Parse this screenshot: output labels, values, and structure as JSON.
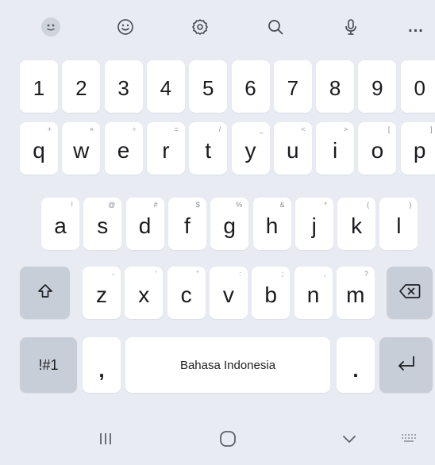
{
  "toolbar": {
    "icons": [
      "emoji-face-icon",
      "smiley-icon",
      "settings-gear-icon",
      "search-icon",
      "microphone-icon",
      "more-icon"
    ],
    "more_label": "..."
  },
  "keyboard": {
    "number_row": [
      "1",
      "2",
      "3",
      "4",
      "5",
      "6",
      "7",
      "8",
      "9",
      "0"
    ],
    "row1": [
      {
        "main": "q",
        "hint": "+"
      },
      {
        "main": "w",
        "hint": "×"
      },
      {
        "main": "e",
        "hint": "÷"
      },
      {
        "main": "r",
        "hint": "="
      },
      {
        "main": "t",
        "hint": "/"
      },
      {
        "main": "y",
        "hint": "_"
      },
      {
        "main": "u",
        "hint": "<"
      },
      {
        "main": "i",
        "hint": ">"
      },
      {
        "main": "o",
        "hint": "["
      },
      {
        "main": "p",
        "hint": "]"
      }
    ],
    "row2": [
      {
        "main": "a",
        "hint": "!"
      },
      {
        "main": "s",
        "hint": "@"
      },
      {
        "main": "d",
        "hint": "#"
      },
      {
        "main": "f",
        "hint": "$"
      },
      {
        "main": "g",
        "hint": "%"
      },
      {
        "main": "h",
        "hint": "&"
      },
      {
        "main": "j",
        "hint": "*"
      },
      {
        "main": "k",
        "hint": "("
      },
      {
        "main": "l",
        "hint": ")"
      }
    ],
    "row3": [
      {
        "main": "z",
        "hint": "-"
      },
      {
        "main": "x",
        "hint": "'"
      },
      {
        "main": "c",
        "hint": "\""
      },
      {
        "main": "v",
        "hint": ":"
      },
      {
        "main": "b",
        "hint": ";"
      },
      {
        "main": "n",
        "hint": ","
      },
      {
        "main": "m",
        "hint": "?"
      }
    ],
    "symbols_label": "!#1",
    "comma_label": ",",
    "space_label": "Bahasa Indonesia",
    "period_label": ".",
    "shift_icon": "shift-arrow-icon",
    "backspace_icon": "backspace-icon",
    "enter_icon": "enter-return-icon"
  },
  "navbar": {
    "icons": [
      "recent-apps-icon",
      "home-icon",
      "back-chevron-icon",
      "keyboard-switch-icon"
    ]
  },
  "colors": {
    "background": "#e8ecf2",
    "key": "#ffffff",
    "key_dark": "#c8ced8",
    "text": "#1b1b1f",
    "hint": "#8a8f98"
  }
}
